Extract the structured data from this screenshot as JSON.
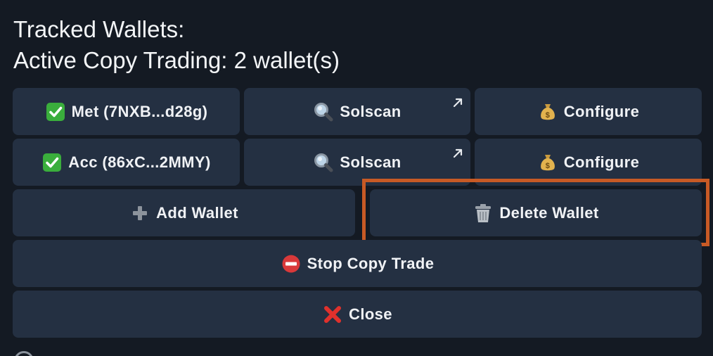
{
  "header": {
    "title": "Tracked Wallets:",
    "subtitle": "Active Copy Trading: 2 wallet(s)"
  },
  "wallets": [
    {
      "label": "Met (7NXB...d28g)",
      "status_icon": "check-mark-icon",
      "solscan_label": "Solscan",
      "configure_label": "Configure"
    },
    {
      "label": "Acc (86xC...2MMY)",
      "status_icon": "check-mark-icon",
      "solscan_label": "Solscan",
      "configure_label": "Configure"
    }
  ],
  "actions": {
    "add_wallet": "Add Wallet",
    "delete_wallet": "Delete Wallet",
    "stop_copy_trade": "Stop Copy Trade",
    "close": "Close"
  },
  "icons": {
    "solscan": "magnifier-icon",
    "configure": "money-bag-icon",
    "external": "external-link-arrow-icon",
    "add": "plus-icon",
    "delete": "trash-icon",
    "stop": "no-entry-icon",
    "close": "red-x-icon"
  },
  "colors": {
    "background": "#141a23",
    "button": "#243042",
    "text": "#f0f2f5",
    "highlight": "#c85a25",
    "check_green": "#3aae3c",
    "stop_red": "#d9393a",
    "close_red": "#e0312c"
  }
}
